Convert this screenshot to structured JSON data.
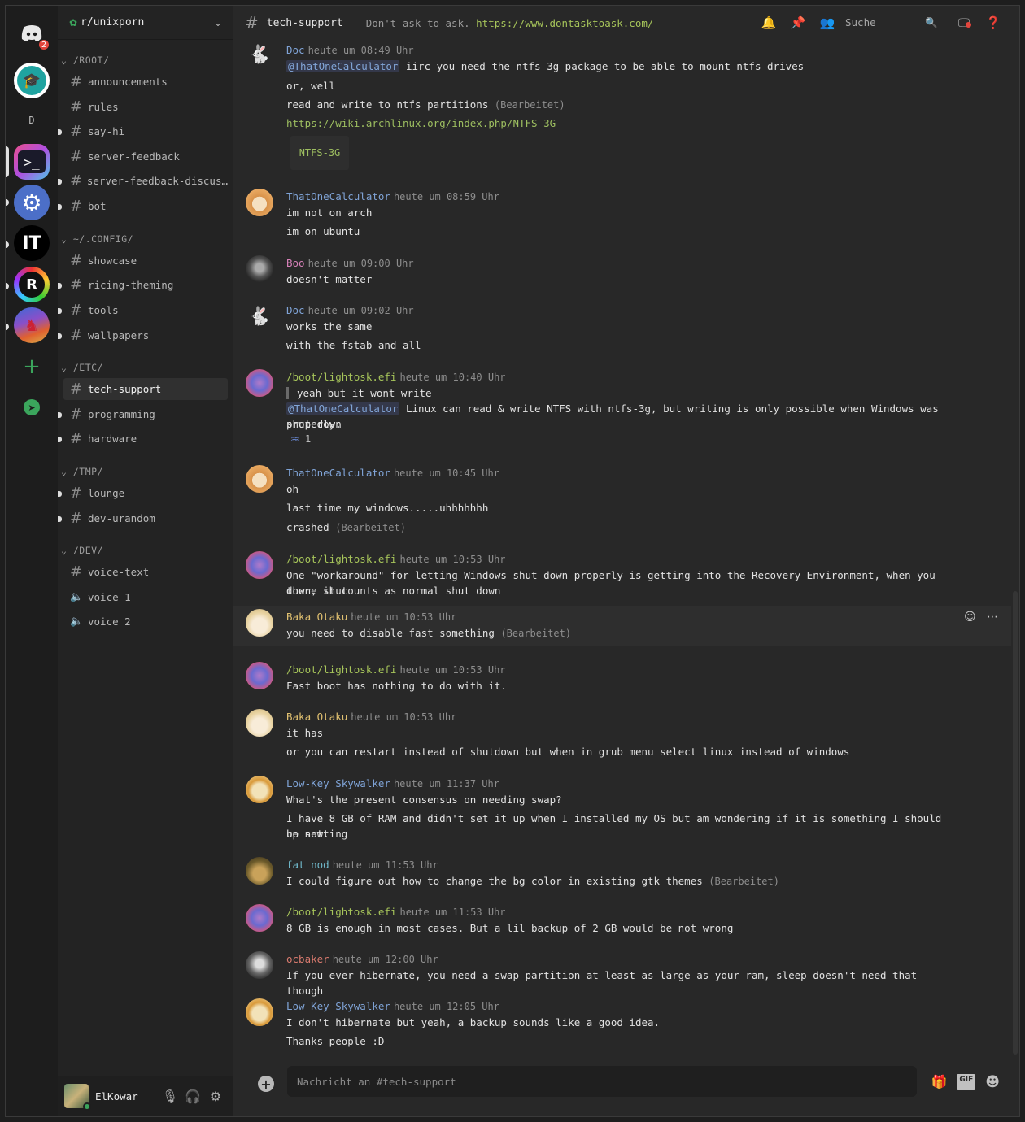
{
  "colors": {
    "accent_green": "#9dbe60",
    "mention": "#82a6d8",
    "unread_badge": "#e2453c",
    "online": "#3ba55c"
  },
  "rail": {
    "dm_badge": "2",
    "dm_letter": "D",
    "servers": [
      "graduation-cap-server",
      "terminal-server",
      "gear-server",
      "IT",
      "rust-server",
      "dragon-server"
    ],
    "it_label": "IT"
  },
  "guild": {
    "name": "r/unixporn"
  },
  "categories": [
    {
      "name": "/ROOT/",
      "channels": [
        "announcements",
        "rules",
        "say-hi",
        "server-feedback",
        "server-feedback-discus…",
        "bot"
      ]
    },
    {
      "name": "~/.CONFIG/",
      "channels": [
        "showcase",
        "ricing-theming",
        "tools",
        "wallpapers"
      ]
    },
    {
      "name": "/ETC/",
      "channels": [
        "tech-support",
        "programming",
        "hardware"
      ]
    },
    {
      "name": "/TMP/",
      "channels": [
        "lounge",
        "dev-urandom"
      ]
    },
    {
      "name": "/DEV/",
      "channels": [
        "voice-text",
        "voice 1",
        "voice 2"
      ]
    }
  ],
  "user": {
    "name": "ElKowar"
  },
  "channel": {
    "name": "tech-support",
    "topic": "Don't ask to ask.",
    "topic_link": "https://www.dontasktoask.com/",
    "search": "Suche"
  },
  "messages": [
    {
      "author": "Doc",
      "time": "heute um 08:49 Uhr",
      "mention": "@ThatOneCalculator",
      "lines": [
        "iirc you need the ntfs-3g package to be able to mount ntfs drives",
        "or, well",
        "read and write to ntfs partitions",
        "https://wiki.archlinux.org/index.php/NTFS-3G"
      ],
      "edited": "(Bearbeitet)",
      "embed": "NTFS-3G"
    },
    {
      "author": "ThatOneCalculator",
      "time": "heute um 08:59 Uhr",
      "lines": [
        "im not on arch",
        "im on ubuntu"
      ]
    },
    {
      "author": "Boo",
      "time": "heute um 09:00 Uhr",
      "lines": [
        "doesn't matter"
      ]
    },
    {
      "author": "Doc",
      "time": "heute um 09:02 Uhr",
      "lines": [
        "works the same",
        "with the fstab and all"
      ]
    },
    {
      "author": "/boot/lightosk.efi",
      "time": "heute um 10:40 Uhr",
      "quote": "yeah but it wont write",
      "mention": "@ThatOneCalculator",
      "lines": [
        "Linux can read & write NTFS with ntfs-3g, but writing is only possible when Windows was shut down",
        "properly."
      ],
      "reaction": "1"
    },
    {
      "author": "ThatOneCalculator",
      "time": "heute um 10:45 Uhr",
      "lines": [
        "oh",
        "last time my windows.....uhhhhhhh",
        "crashed"
      ],
      "edited": "(Bearbeitet)"
    },
    {
      "author": "/boot/lightosk.efi",
      "time": "heute um 10:53 Uhr",
      "lines": [
        "One \"workaround\" for letting Windows shut down properly is getting into the Recovery Environment, when you there shut",
        "down, it counts as normal shut down"
      ]
    },
    {
      "author": "Baka Otaku",
      "time": "heute um 10:53 Uhr",
      "lines": [
        "you need to disable fast something"
      ],
      "edited": "(Bearbeitet)"
    },
    {
      "author": "/boot/lightosk.efi",
      "time": "heute um 10:53 Uhr",
      "lines": [
        "Fast boot has nothing to do with it."
      ]
    },
    {
      "author": "Baka Otaku",
      "time": "heute um 10:53 Uhr",
      "lines": [
        "it has",
        "or you can restart instead of shutdown but when in grub menu select linux instead of windows"
      ]
    },
    {
      "author": "Low-Key Skywalker",
      "time": "heute um 11:37 Uhr",
      "lines": [
        "What's the present consensus on needing swap?",
        "I have 8 GB of RAM and didn't set it up when I installed my OS but am wondering if it is something I should be setting",
        "up now."
      ]
    },
    {
      "author": "fat nod",
      "time": "heute um 11:53 Uhr",
      "lines": [
        "I could figure out how to change the bg color in existing gtk themes"
      ],
      "edited": "(Bearbeitet)"
    },
    {
      "author": "/boot/lightosk.efi",
      "time": "heute um 11:53 Uhr",
      "lines": [
        "8 GB is enough in most cases. But a lil backup of 2 GB would be not wrong"
      ]
    },
    {
      "author": "ocbaker",
      "time": "heute um 12:00 Uhr",
      "lines": [
        "If you ever hibernate, you need a swap partition at least as large as your ram, sleep doesn't need that though"
      ]
    },
    {
      "author": "Low-Key Skywalker",
      "time": "heute um 12:05 Uhr",
      "lines": [
        "I don't hibernate but yeah, a backup sounds like a good idea.",
        "Thanks people :D"
      ]
    }
  ],
  "author_colors": {
    "Doc": "#7fa3d6",
    "ThatOneCalculator": "#7fa3d6",
    "Boo": "#d680b8",
    "/boot/lightosk.efi": "#a6c45a",
    "Baka Otaku": "#e0c070",
    "Low-Key Skywalker": "#7fa3d6",
    "fat nod": "#6fb7c9",
    "ocbaker": "#d87a6e"
  },
  "composer": {
    "placeholder": "Nachricht an #tech-support",
    "gif": "GIF"
  }
}
